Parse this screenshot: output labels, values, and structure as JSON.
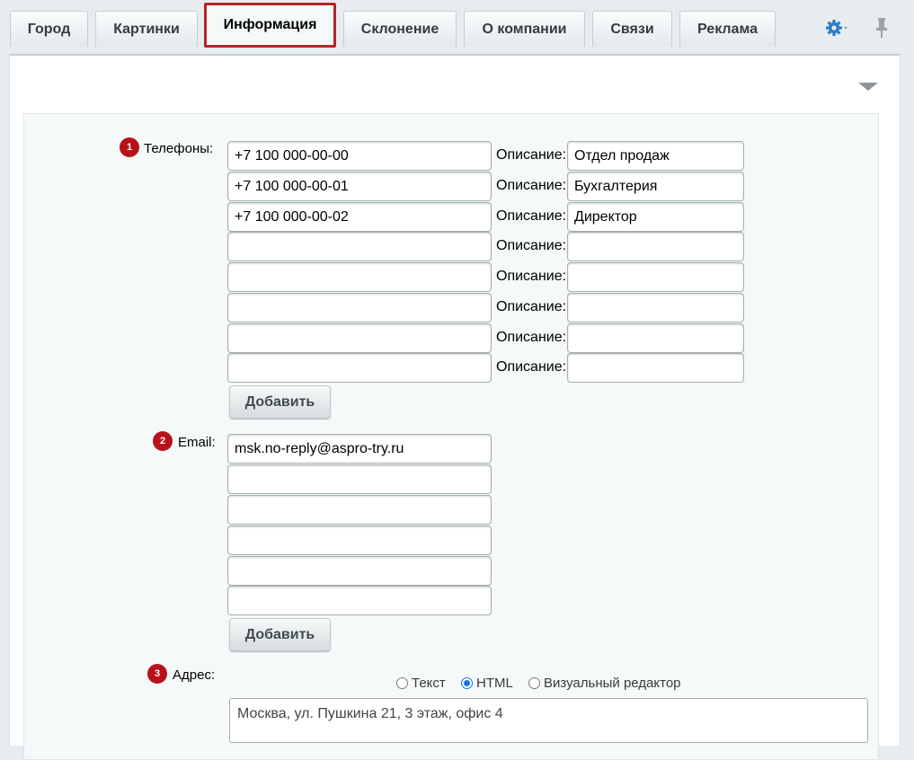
{
  "tabs": [
    {
      "label": "Город"
    },
    {
      "label": "Картинки"
    },
    {
      "label": "Информация"
    },
    {
      "label": "Склонение"
    },
    {
      "label": "О компании"
    },
    {
      "label": "Связи"
    },
    {
      "label": "Реклама"
    }
  ],
  "phones": {
    "badge": "1",
    "label": "Телефоны:",
    "desc_label": "Описание:",
    "rows": [
      {
        "phone": "+7 100 000-00-00",
        "desc": "Отдел продаж"
      },
      {
        "phone": "+7 100 000-00-01",
        "desc": "Бухгалтерия"
      },
      {
        "phone": "+7 100 000-00-02",
        "desc": "Директор"
      },
      {
        "phone": "",
        "desc": ""
      },
      {
        "phone": "",
        "desc": ""
      },
      {
        "phone": "",
        "desc": ""
      },
      {
        "phone": "",
        "desc": ""
      },
      {
        "phone": "",
        "desc": ""
      }
    ],
    "add_label": "Добавить"
  },
  "email": {
    "badge": "2",
    "label": "Email:",
    "rows": [
      "msk.no-reply@aspro-try.ru",
      "",
      "",
      "",
      "",
      ""
    ],
    "add_label": "Добавить"
  },
  "address": {
    "badge": "3",
    "label": "Адрес:",
    "modes": [
      {
        "label": "Текст",
        "checked": false
      },
      {
        "label": "HTML",
        "checked": true
      },
      {
        "label": "Визуальный редактор",
        "checked": false
      }
    ],
    "value": "Москва, ул. Пушкина 21, 3 этаж, офис 4"
  },
  "icons": {
    "settings": "gear-icon",
    "pin": "pin-icon",
    "collapse": "collapse-arrow-icon"
  },
  "colors": {
    "active_tab_border": "#b7242a",
    "badge": "#b7121a",
    "radio_checked": "#1a73e8"
  }
}
